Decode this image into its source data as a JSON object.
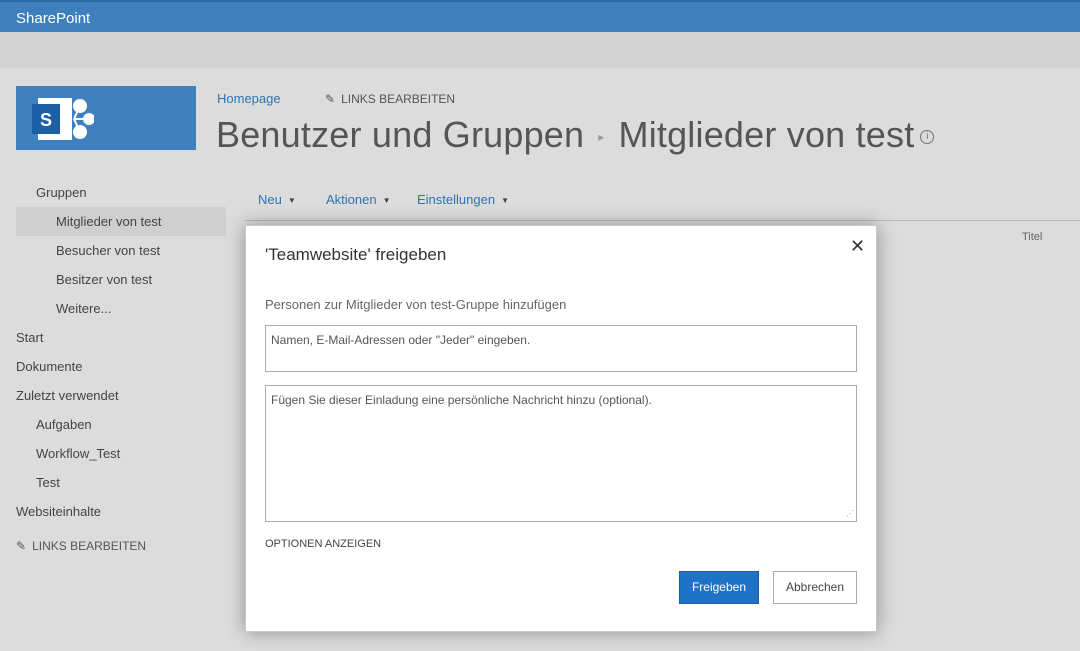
{
  "suite_bar": {
    "brand": "SharePoint"
  },
  "top_nav": {
    "home": "Homepage",
    "edit_links": "LINKS BEARBEITEN"
  },
  "page_title": {
    "parent": "Benutzer und Gruppen",
    "current": "Mitglieder von test",
    "info_icon": "i"
  },
  "left_nav": {
    "items": [
      {
        "label": "Gruppen",
        "level": 1
      },
      {
        "label": "Mitglieder von test",
        "level": 2,
        "selected": true
      },
      {
        "label": "Besucher von test",
        "level": 2
      },
      {
        "label": "Besitzer von test",
        "level": 2
      },
      {
        "label": "Weitere...",
        "level": 2
      },
      {
        "label": "Start",
        "level": 0
      },
      {
        "label": "Dokumente",
        "level": 0
      },
      {
        "label": "Zuletzt verwendet",
        "level": 0
      },
      {
        "label": "Aufgaben",
        "level": 1
      },
      {
        "label": "Workflow_Test",
        "level": 1
      },
      {
        "label": "Test",
        "level": 1
      },
      {
        "label": "Websiteinhalte",
        "level": 0
      }
    ],
    "edit_links": "LINKS BEARBEITEN"
  },
  "toolbar": {
    "new": "Neu",
    "actions": "Aktionen",
    "settings": "Einstellungen"
  },
  "list": {
    "column_title": "Titel"
  },
  "dialog": {
    "title": "'Teamwebsite' freigeben",
    "close_glyph": "✕",
    "subtitle": "Personen zur Mitglieder von test-Gruppe hinzufügen",
    "names_placeholder": "Namen, E-Mail-Adressen oder \"Jeder\" eingeben.",
    "message_placeholder": "Fügen Sie dieser Einladung eine persönliche Nachricht hinzu (optional).",
    "show_options": "OPTIONEN ANZEIGEN",
    "share_button": "Freigeben",
    "cancel_button": "Abbrechen"
  },
  "colors": {
    "suite_bar": "#3d80bd",
    "link": "#2e74b5",
    "primary_button": "#1f72c5"
  }
}
